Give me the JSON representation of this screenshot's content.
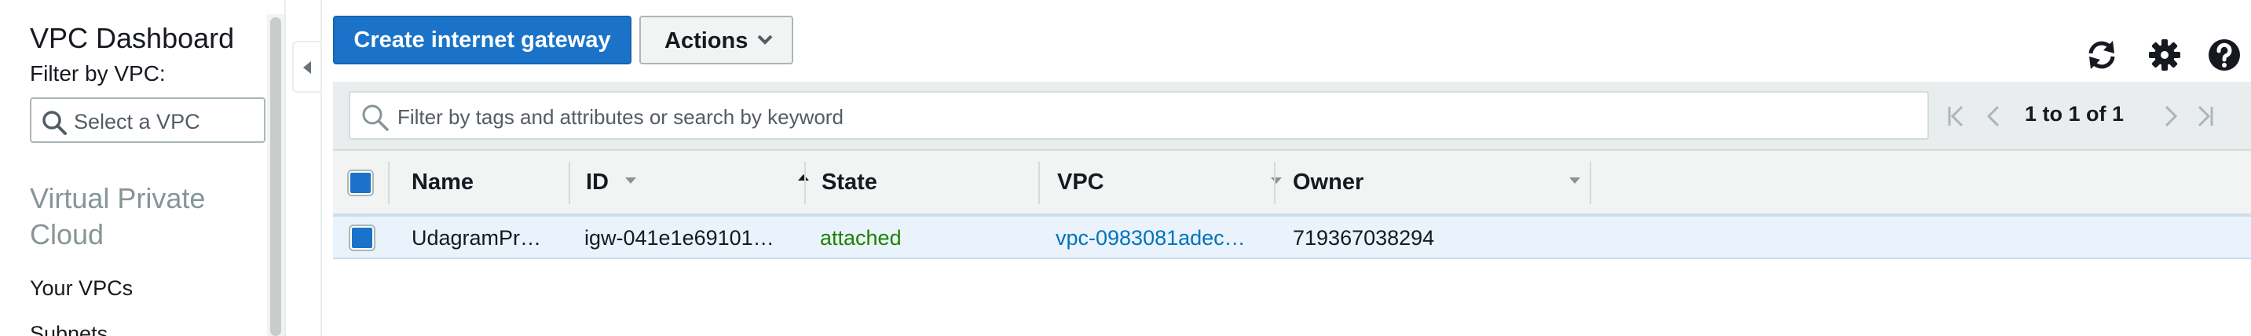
{
  "sidebar": {
    "title": "VPC Dashboard",
    "filter_label": "Filter by VPC:",
    "vpc_select_placeholder": "Select a VPC",
    "section_title": "Virtual Private Cloud",
    "links": [
      "Your VPCs",
      "Subnets"
    ]
  },
  "toolbar": {
    "create_button": "Create internet gateway",
    "actions_button": "Actions",
    "icons": [
      "refresh-icon",
      "gear-icon",
      "help-icon"
    ]
  },
  "search": {
    "placeholder": "Filter by tags and attributes or search by keyword"
  },
  "pagination": {
    "text": "1 to 1 of 1"
  },
  "table": {
    "columns": [
      "Name",
      "ID",
      "State",
      "VPC",
      "Owner"
    ],
    "sorted_column": "ID",
    "rows": [
      {
        "selected": true,
        "name": "UdagramPr…",
        "id": "igw-041e1e69101…",
        "state": "attached",
        "vpc": "vpc-0983081adec…",
        "owner": "719367038294"
      }
    ]
  },
  "colors": {
    "primary": "#1a73c8",
    "state_ok": "#1d8102",
    "link": "#0073bb"
  }
}
